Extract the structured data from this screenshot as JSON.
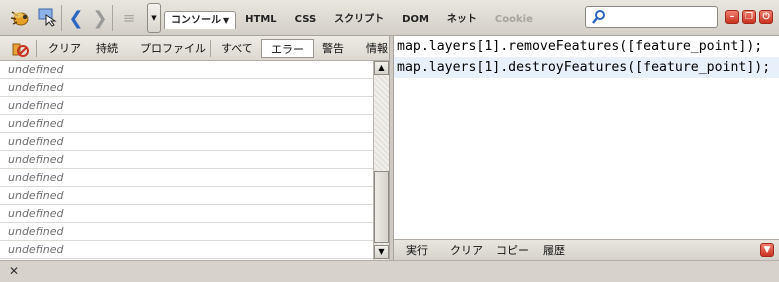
{
  "toolbar": {
    "icons": [
      "firebug-icon",
      "inspect-icon",
      "back-icon",
      "forward-icon",
      "menu-icon",
      "dropdown-arrow-icon"
    ],
    "tabs": [
      {
        "label": "コンソール",
        "active": true
      },
      {
        "label": "HTML",
        "active": false
      },
      {
        "label": "CSS",
        "active": false
      },
      {
        "label": "スクリプト",
        "active": false
      },
      {
        "label": "DOM",
        "active": false
      },
      {
        "label": "ネット",
        "active": false
      },
      {
        "label": "Cookie",
        "disabled": true
      }
    ],
    "search": {
      "value": "",
      "placeholder": ""
    },
    "window_buttons": [
      "minimize-icon",
      "restore-icon",
      "power-icon"
    ]
  },
  "console_bar": {
    "clear_label": "クリア",
    "persist_label": "持続",
    "profile_label": "プロファイル",
    "filters": [
      "すべて",
      "エラー",
      "警告",
      "情報"
    ],
    "active_filter": "エラー"
  },
  "log": {
    "entries": [
      "undefined",
      "undefined",
      "undefined",
      "undefined",
      "undefined",
      "undefined",
      "undefined",
      "undefined",
      "undefined",
      "undefined",
      "undefined"
    ]
  },
  "editor": {
    "lines": [
      "map.layers[1].removeFeatures([feature_point]);",
      "map.layers[1].destroyFeatures([feature_point]);"
    ],
    "run_label": "実行",
    "clear_label": "クリア",
    "copy_label": "コピー",
    "history_label": "履歴"
  },
  "colors": {
    "accent": "#2d66c3",
    "close_red": "#d9472f",
    "chrome": "#d7d3cc"
  }
}
